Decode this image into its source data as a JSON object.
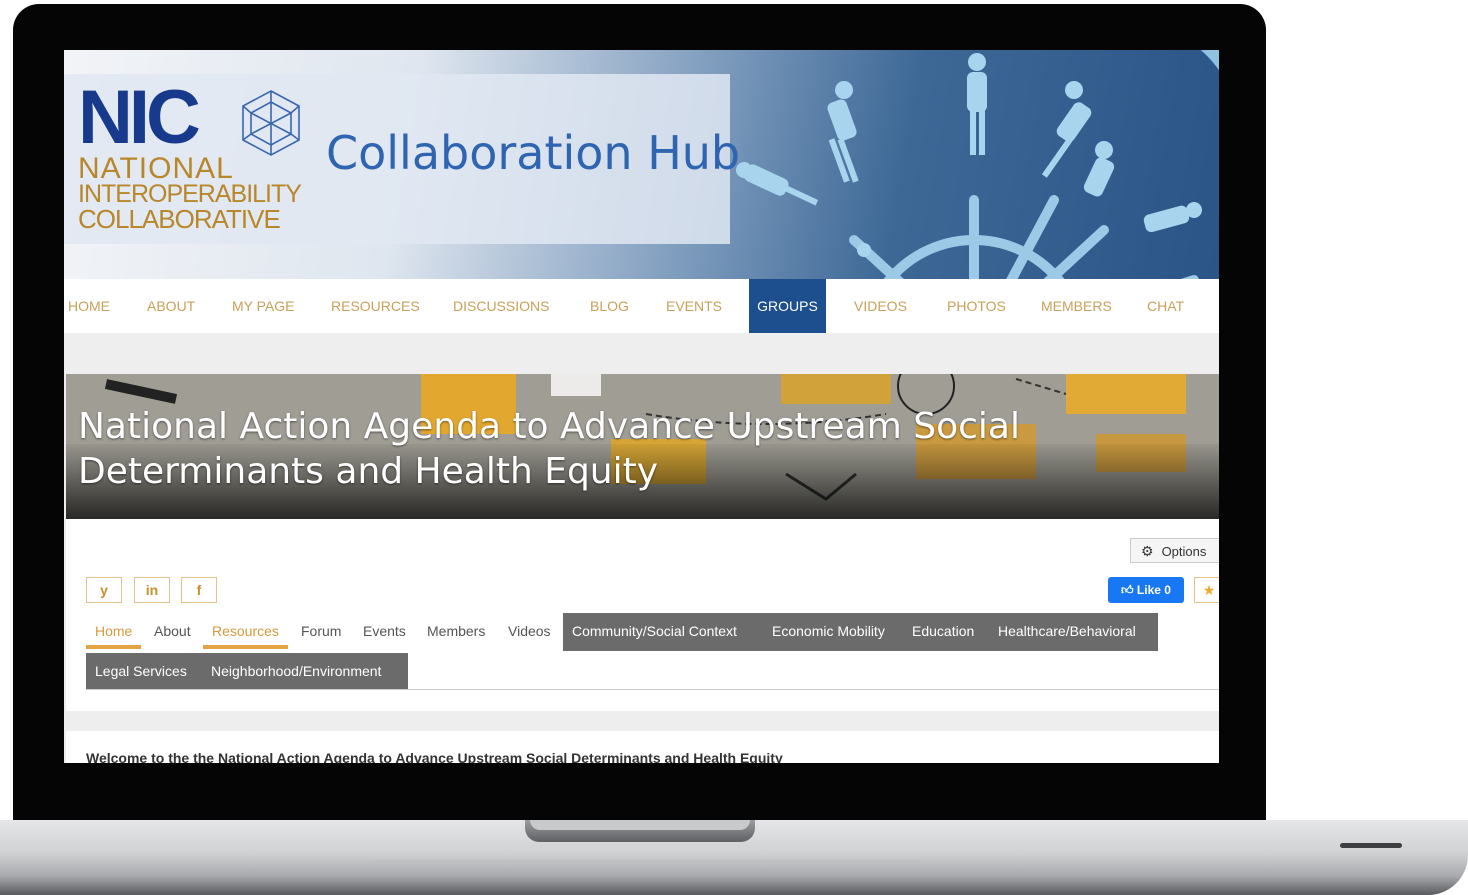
{
  "header": {
    "logo_acronym": "NIC",
    "logo_line1": "NATIONAL",
    "logo_line2": "INTEROPERABILITY",
    "logo_line3": "COLLABORATIVE",
    "site_title": "Collaboration Hub"
  },
  "topnav": {
    "items": [
      {
        "label": "HOME"
      },
      {
        "label": "ABOUT"
      },
      {
        "label": "MY PAGE"
      },
      {
        "label": "RESOURCES"
      },
      {
        "label": "DISCUSSIONS"
      },
      {
        "label": "BLOG"
      },
      {
        "label": "EVENTS"
      },
      {
        "label": "GROUPS",
        "active": true
      },
      {
        "label": "VIDEOS"
      },
      {
        "label": "PHOTOS"
      },
      {
        "label": "MEMBERS"
      },
      {
        "label": "CHAT"
      }
    ]
  },
  "group": {
    "title": "National Action Agenda to Advance Upstream Social Determinants and Health Equity",
    "options_label": "Options",
    "like_label": "Like 0",
    "social": {
      "twitter": "y",
      "linkedin": "in",
      "facebook": "f"
    },
    "tabs": [
      {
        "label": "Home"
      },
      {
        "label": "About"
      },
      {
        "label": "Resources"
      },
      {
        "label": "Forum"
      },
      {
        "label": "Events"
      },
      {
        "label": "Members"
      },
      {
        "label": "Videos"
      },
      {
        "label": "Community/Social Context"
      },
      {
        "label": "Economic Mobility"
      },
      {
        "label": "Education"
      },
      {
        "label": "Healthcare/Behavioral"
      },
      {
        "label": "Legal Services"
      },
      {
        "label": "Neighborhood/Environment"
      }
    ],
    "welcome_text": "Welcome to the the National Action Agenda to Advance Upstream Social Determinants and Health Equity"
  },
  "colors": {
    "nav_active": "#1d4f8f",
    "nav_text": "#c9a15a",
    "logo_blue": "#183a8c",
    "logo_gold": "#b8872a",
    "tab_dark": "#6b6b6b",
    "tab_orange": "#d79a3e"
  },
  "icons": {
    "gem": "geodesic-gem-icon",
    "gear": "gear-icon",
    "star": "star-icon",
    "thumb": "thumbs-up-icon"
  }
}
